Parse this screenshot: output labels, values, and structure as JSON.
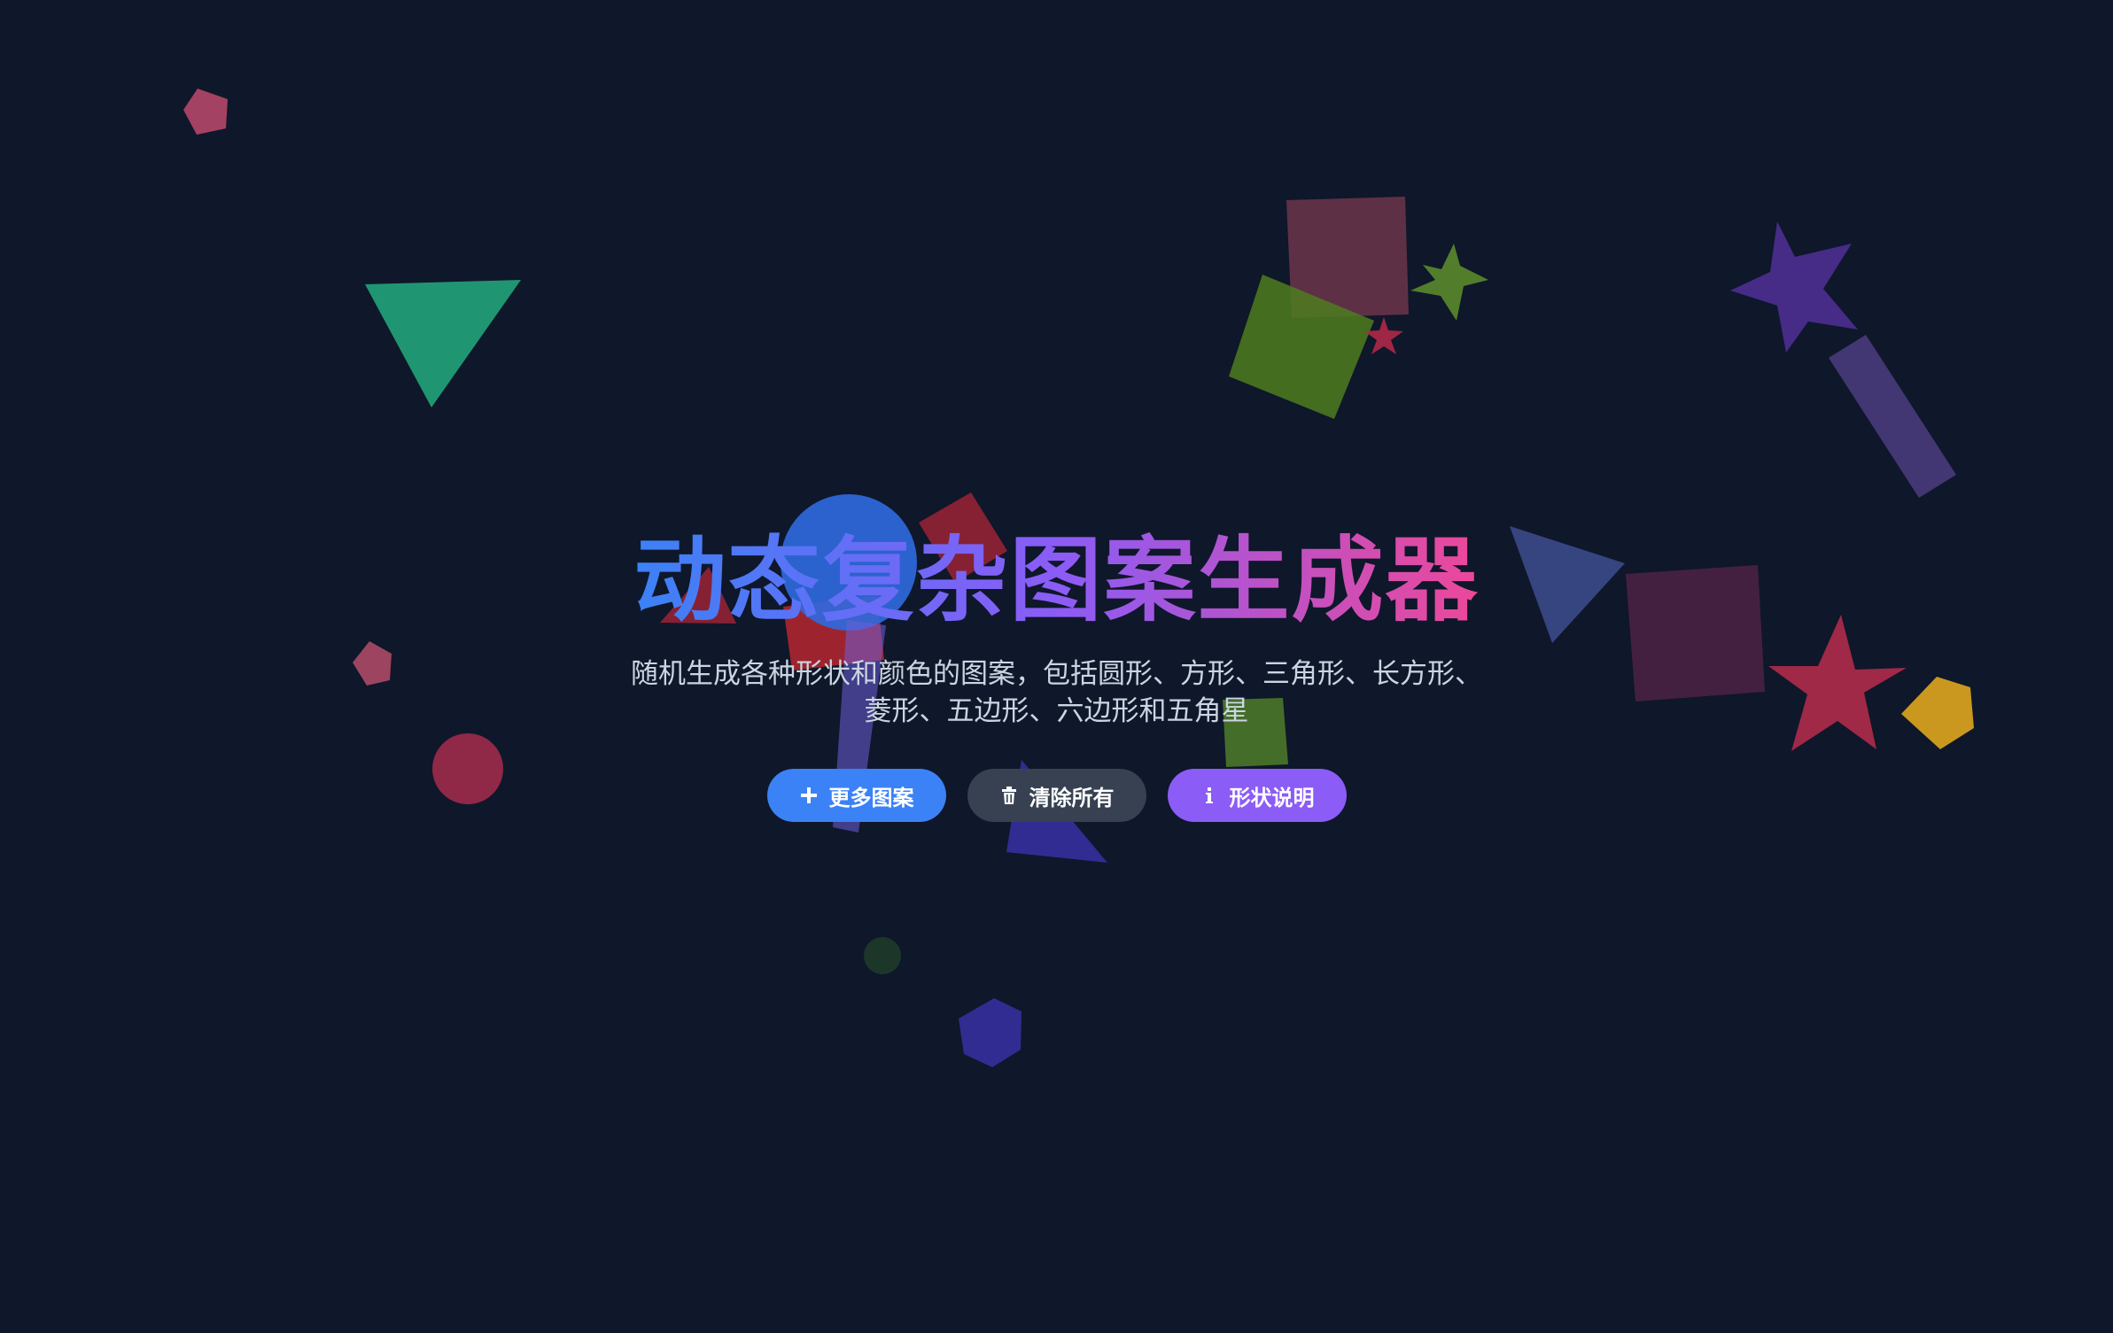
{
  "hero": {
    "title": "动态复杂图案生成器",
    "subtitle": "随机生成各种形状和颜色的图案，包括圆形、方形、三角形、长方形、菱形、五边形、六边形和五角星"
  },
  "buttons": {
    "more": {
      "label": "更多图案",
      "icon": "plus-icon",
      "color": "#3b82f6"
    },
    "clear": {
      "label": "清除所有",
      "icon": "trash-icon",
      "color": "#374151"
    },
    "info": {
      "label": "形状说明",
      "icon": "info-icon",
      "color": "#8b5cf6"
    }
  },
  "theme": {
    "background": "#0f172a",
    "title_gradient": [
      "#3b82f6",
      "#8b5cf6",
      "#ec4899"
    ],
    "subtitle_color": "#cbd5e1"
  }
}
